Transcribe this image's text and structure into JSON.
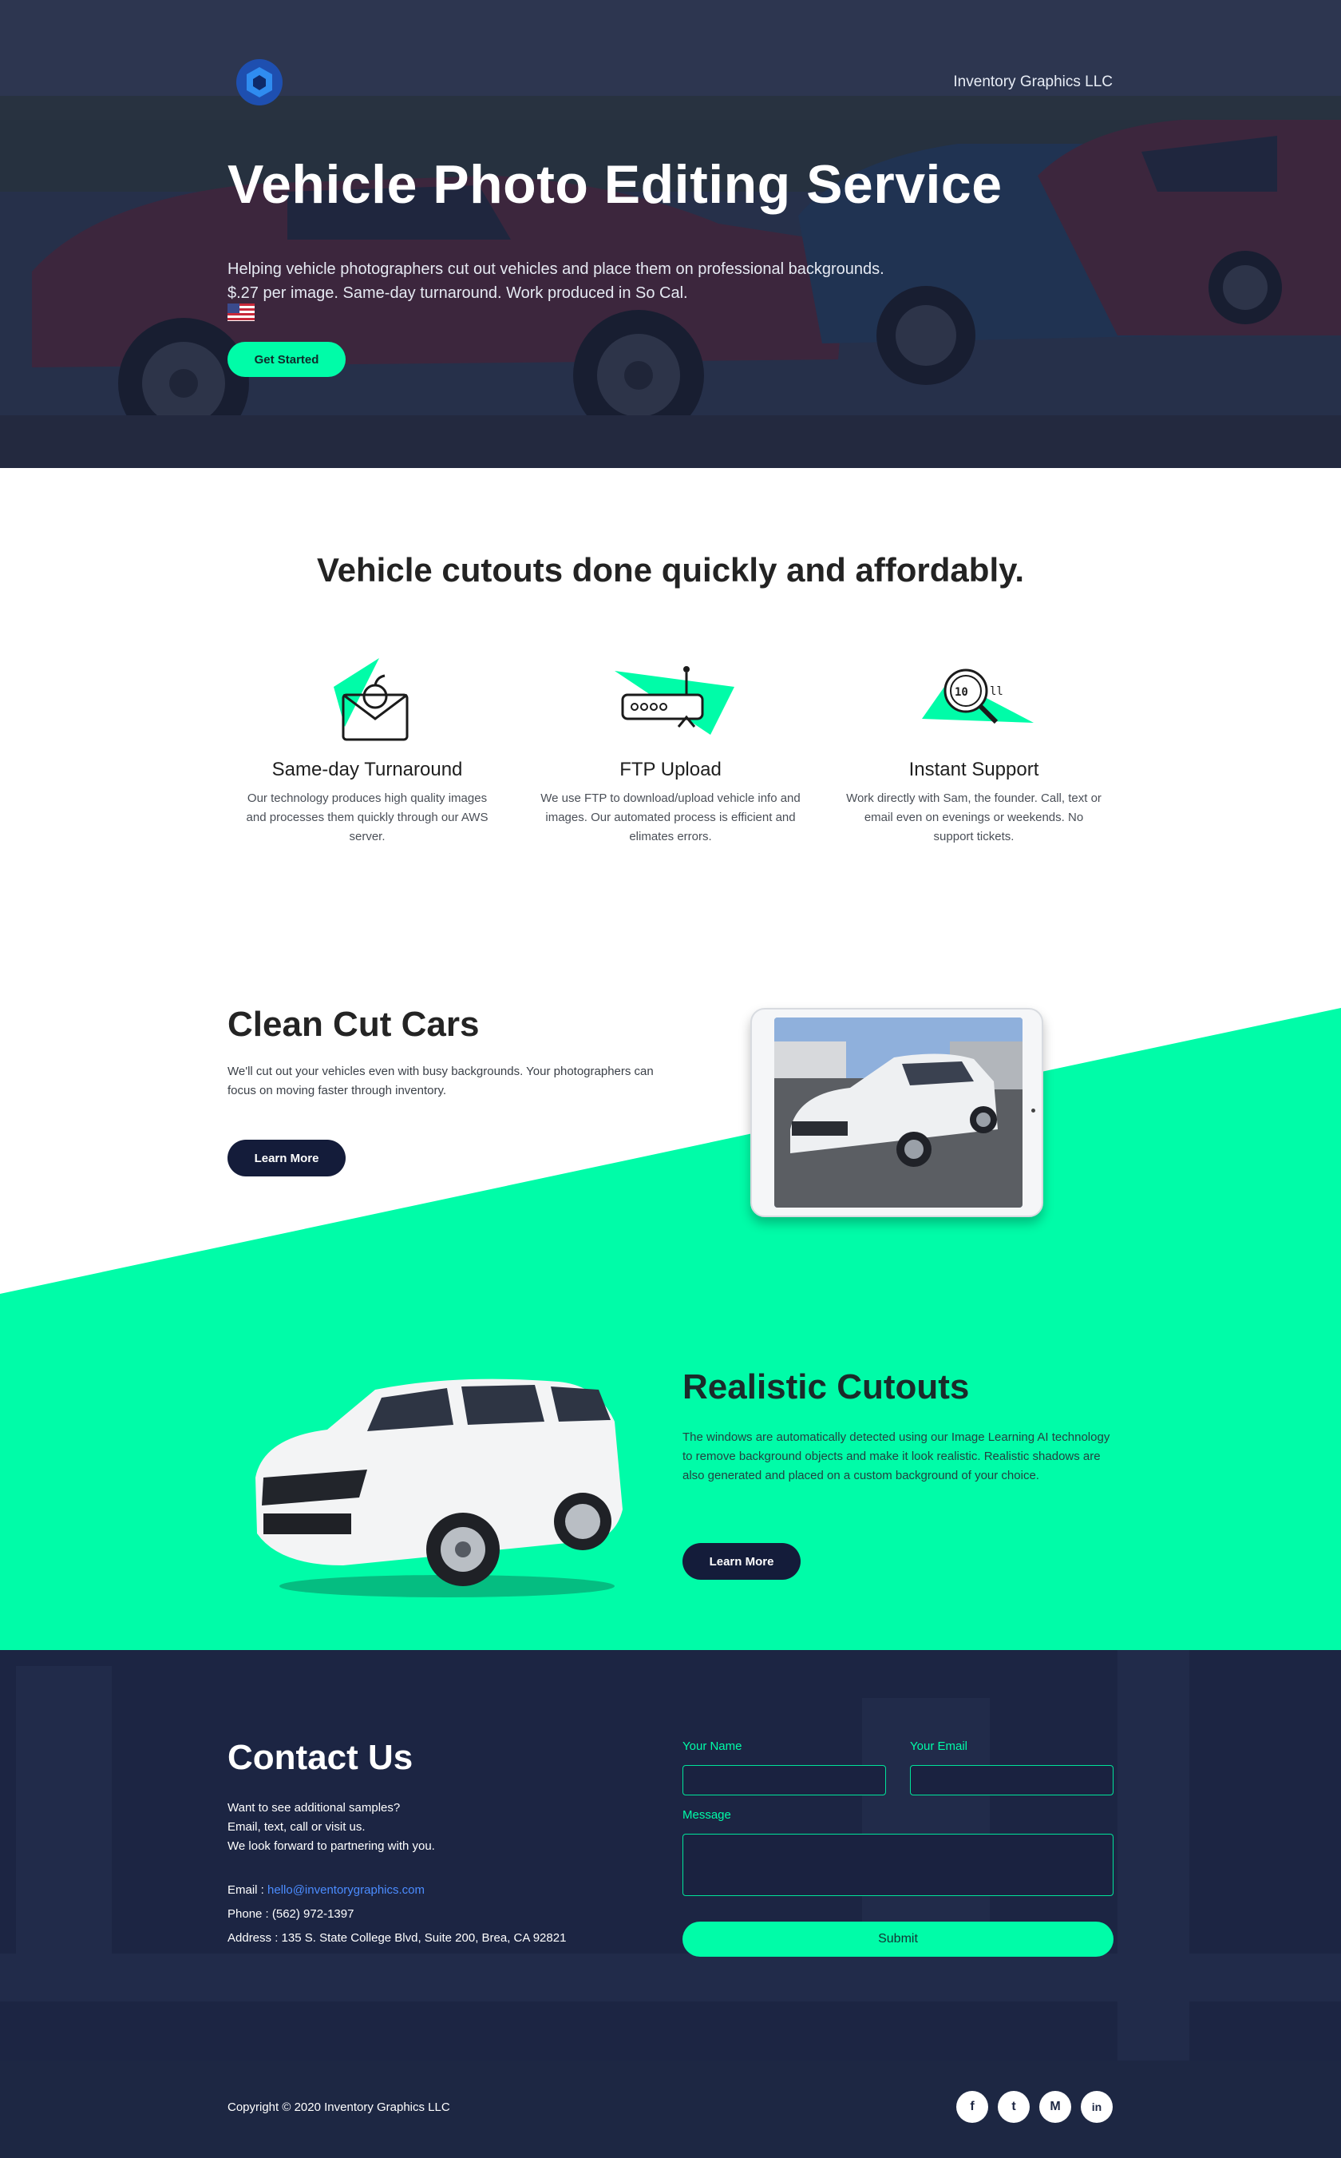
{
  "header": {
    "brand": "Inventory Graphics LLC",
    "logo_icon": "hexagon-logo-icon"
  },
  "hero": {
    "title": "Vehicle Photo Editing Service",
    "subtitle_line1": "Helping vehicle photographers cut out vehicles and place them on professional backgrounds.",
    "subtitle_line2": "$.27 per image. Same-day turnaround. Work produced in So Cal.",
    "flag_icon": "us-flag-icon",
    "cta_label": "Get Started"
  },
  "features": {
    "title": "Vehicle cutouts done quickly and affordably.",
    "items": [
      {
        "icon": "envelope-bomb-icon",
        "title": "Same-day Turnaround",
        "text": "Our technology produces high quality images and processes them quickly through our AWS server."
      },
      {
        "icon": "router-upload-icon",
        "title": "FTP Upload",
        "text": "We use FTP to download/upload vehicle info and images. Our automated process is efficient and elimates errors."
      },
      {
        "icon": "magnifier-binary-icon",
        "title": "Instant Support",
        "text": "Work directly with Sam, the founder. Call, text or email even on evenings or weekends. No support tickets."
      }
    ]
  },
  "clean_cut": {
    "title": "Clean Cut Cars",
    "text": "We'll cut out your vehicles even with busy backgrounds. Your photographers can focus on moving faster through inventory.",
    "button": "Learn More"
  },
  "realistic": {
    "title": "Realistic Cutouts",
    "text": "The windows are automatically detected using our Image Learning AI technology to remove background objects and make it look realistic. Realistic shadows are also generated and placed on a custom background of your choice.",
    "button": "Learn More"
  },
  "contact": {
    "title": "Contact Us",
    "line1": "Want to see additional samples?",
    "line2": "Email, text, call or visit us.",
    "line3": "We look forward to partnering with you.",
    "email_label": "Email : ",
    "email": "hello@inventorygraphics.com",
    "phone": "Phone : (562) 972-1397",
    "address": "Address : 135 S. State College Blvd, Suite 200, Brea, CA 92821",
    "form": {
      "name_label": "Your Name",
      "email_label": "Your Email",
      "message_label": "Message",
      "submit": "Submit"
    }
  },
  "footer": {
    "copyright": "Copyright © 2020 Inventory Graphics LLC",
    "social": [
      {
        "icon": "facebook-icon",
        "glyph": "f"
      },
      {
        "icon": "twitter-icon",
        "glyph": "t"
      },
      {
        "icon": "medium-icon",
        "glyph": "M"
      },
      {
        "icon": "linkedin-icon",
        "glyph": "in"
      }
    ]
  },
  "colors": {
    "accent": "#00fca8",
    "navy": "#141c3a",
    "hero_overlay": "#1e2a48"
  }
}
